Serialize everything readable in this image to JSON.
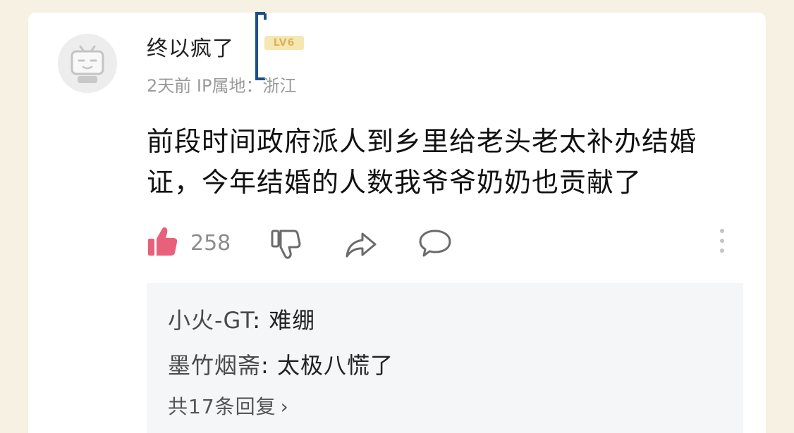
{
  "comment": {
    "username": "终以疯了",
    "level_badge": "LV6",
    "meta": "2天前 IP属地：浙江",
    "text": "前段时间政府派人到乡里给老头老太补办结婚证，今年结婚的人数我爷爷奶奶也贡献了",
    "like_count": "258",
    "icons": {
      "avatar": "bilibili-tv-avatar",
      "like": "thumbs-up-icon",
      "dislike": "thumbs-down-icon",
      "share": "share-icon",
      "reply": "comment-bubble-icon",
      "more": "vertical-dots-icon"
    },
    "colors": {
      "like_active": "#e8607a",
      "muted": "#9a9a9a",
      "badge_bg": "#f5e7b3",
      "badge_fg": "#d9b55a",
      "reply_bg": "#f4f6f8"
    }
  },
  "replies": {
    "items": [
      {
        "author": "小火-GT",
        "separator": ": ",
        "text": "难绷"
      },
      {
        "author": "墨竹烟斋",
        "separator": ": ",
        "text": "太极八慌了"
      }
    ],
    "more_label": "共17条回复",
    "more_chevron": "›"
  }
}
